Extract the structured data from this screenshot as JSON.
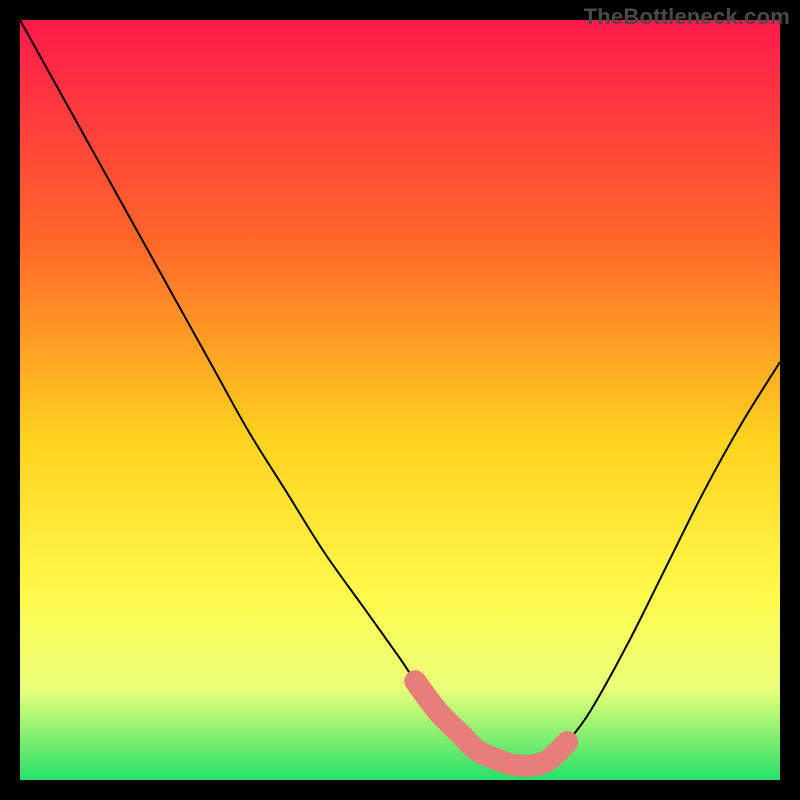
{
  "watermark": "TheBottleneck.com",
  "colors": {
    "background": "#000000",
    "gradient_top": "#ff1a4b",
    "gradient_mid1": "#ff6a2a",
    "gradient_mid2": "#ffd21f",
    "gradient_mid3": "#fff94a",
    "gradient_mid4": "#eaff7a",
    "gradient_bottom": "#25e06a",
    "curve": "#000000",
    "marker": "#e77e79"
  },
  "chart_data": {
    "type": "line",
    "title": "",
    "xlabel": "",
    "ylabel": "",
    "xlim": [
      0,
      100
    ],
    "ylim": [
      0,
      100
    ],
    "grid": false,
    "legend": false,
    "series": [
      {
        "name": "bottleneck-curve",
        "x": [
          0,
          5,
          10,
          15,
          20,
          25,
          30,
          35,
          40,
          45,
          50,
          52,
          55,
          58,
          60,
          62,
          65,
          68,
          70,
          72,
          75,
          80,
          85,
          90,
          95,
          100
        ],
        "values": [
          100,
          91,
          82,
          73,
          64,
          55,
          46,
          38,
          30,
          23,
          16,
          13,
          9,
          6,
          4,
          3,
          2,
          2,
          3,
          5,
          9,
          18,
          28,
          38,
          47,
          55
        ]
      }
    ],
    "markers": {
      "name": "highlight-segment",
      "x_range": [
        52,
        72
      ],
      "y_approx": [
        13,
        3,
        5
      ],
      "note": "thick rounded stroke over the curve near the minimum"
    },
    "gradient_background": {
      "stops": [
        {
          "offset": 0.0,
          "color": "#ff1a4b"
        },
        {
          "offset": 0.3,
          "color": "#ff6a2a"
        },
        {
          "offset": 0.55,
          "color": "#ffd21f"
        },
        {
          "offset": 0.75,
          "color": "#fff94a"
        },
        {
          "offset": 0.88,
          "color": "#eaff7a"
        },
        {
          "offset": 1.0,
          "color": "#25e06a"
        }
      ]
    }
  }
}
